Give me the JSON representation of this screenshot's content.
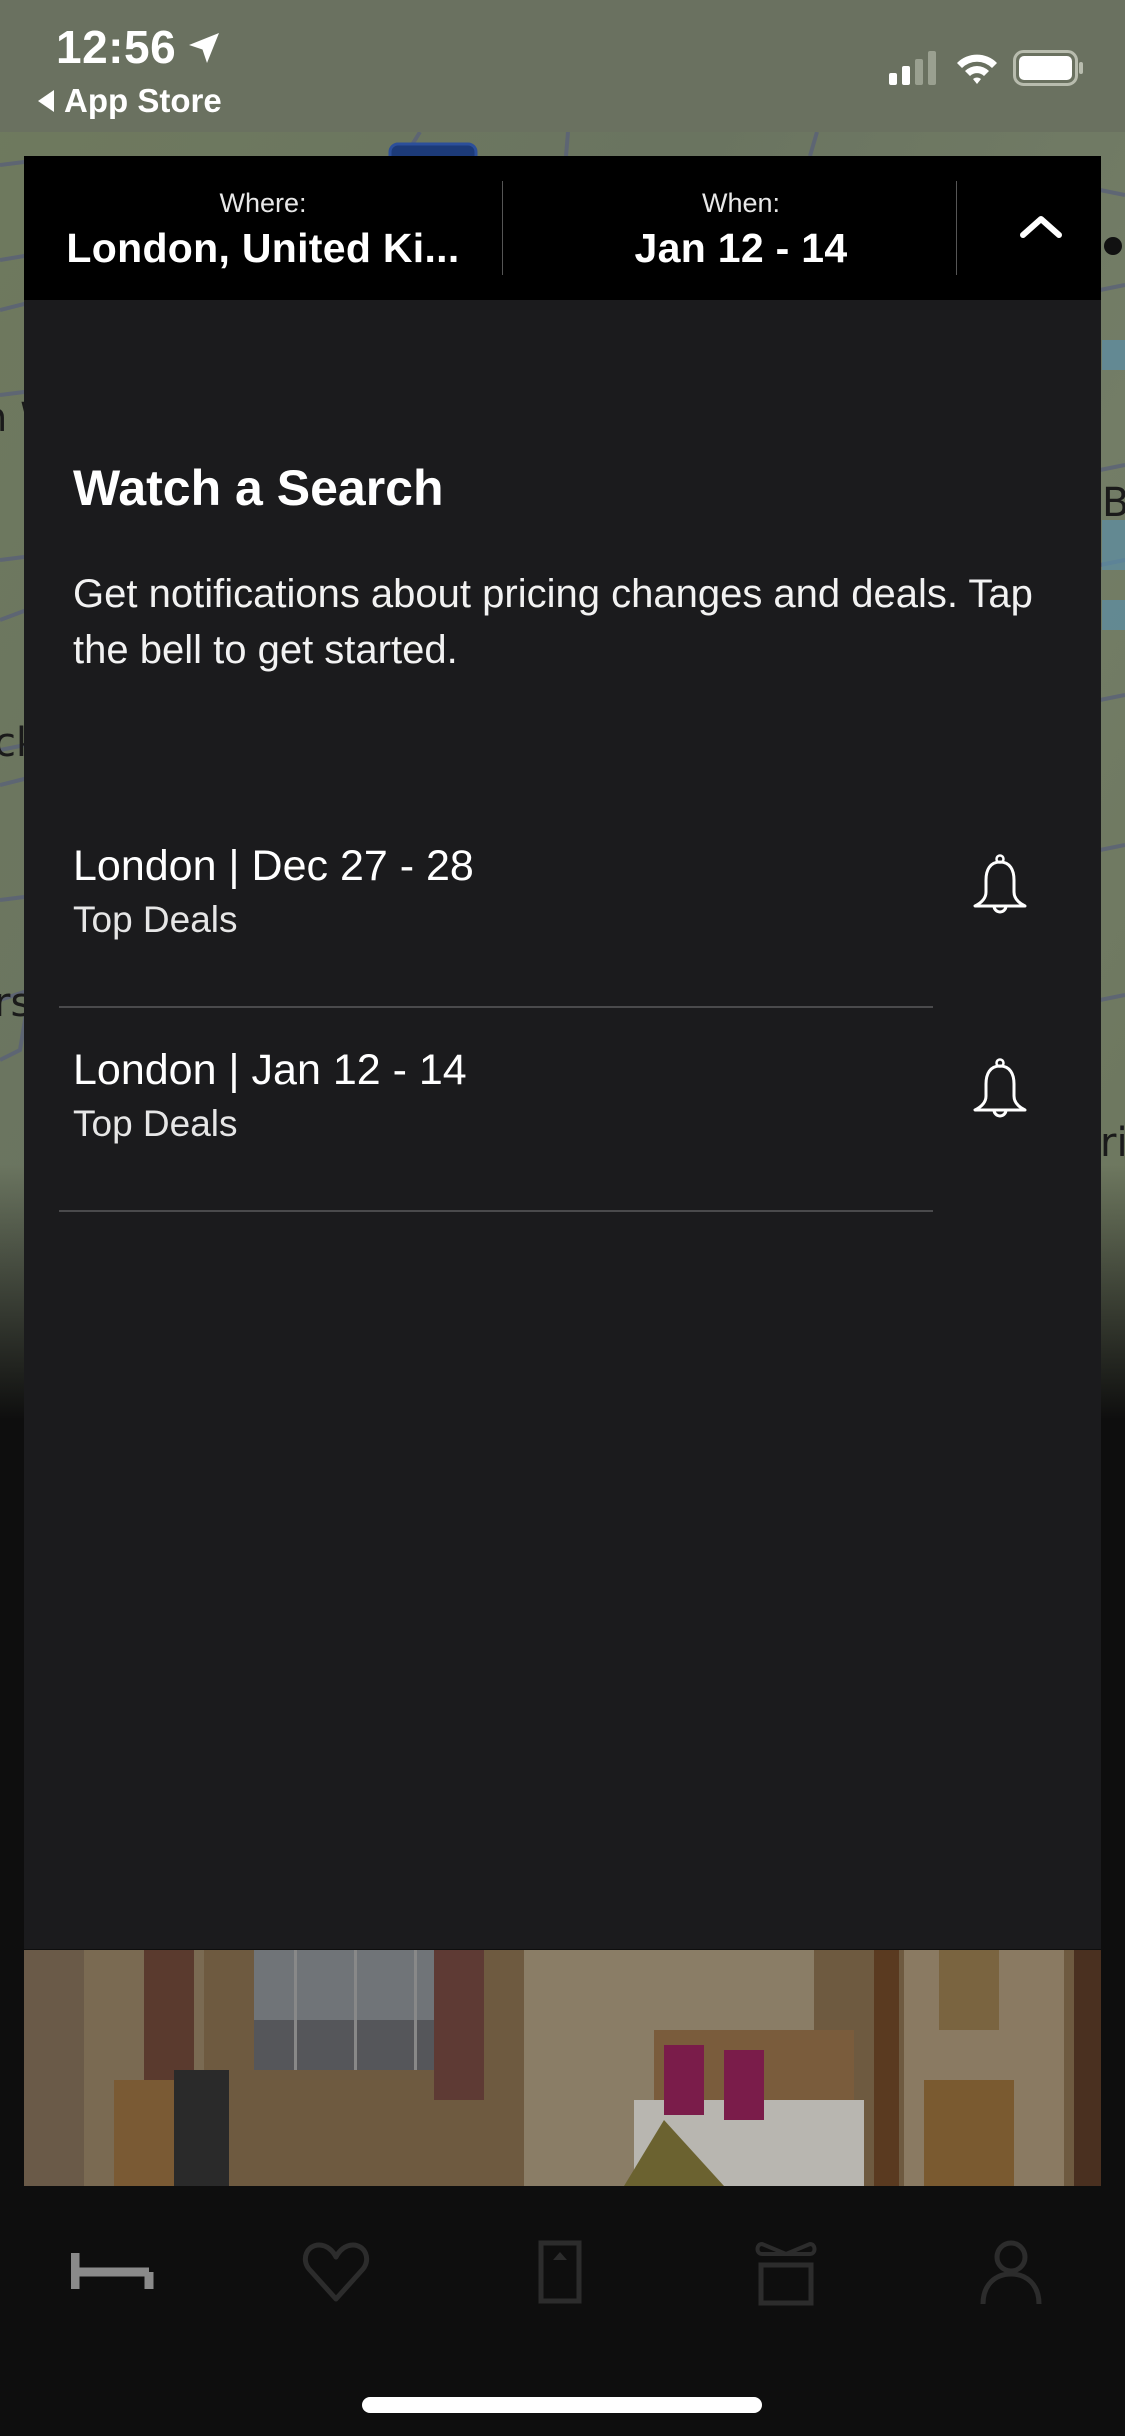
{
  "status_bar": {
    "time": "12:56",
    "back_label": "App Store",
    "icons": [
      "location-arrow-icon",
      "cellular-signal-icon",
      "wifi-icon",
      "battery-icon"
    ]
  },
  "map_labels": [
    "n W",
    "ck",
    "rs",
    "B",
    "ri"
  ],
  "search": {
    "where_label": "Where:",
    "where_value": "London, United Ki...",
    "when_label": "When:",
    "when_value": "Jan 12 - 14",
    "collapse_icon": "chevron-up-icon"
  },
  "watch": {
    "title": "Watch a Search",
    "description": "Get notifications about pricing changes and deals. Tap the bell to get started.",
    "items": [
      {
        "title": "London | Dec 27 - 28",
        "subtitle": "Top Deals",
        "icon": "bell-icon"
      },
      {
        "title": "London | Jan 12 - 14",
        "subtitle": "Top Deals",
        "icon": "bell-icon"
      }
    ]
  },
  "tabbar": {
    "active_index": 0,
    "tabs": [
      {
        "name": "stays",
        "icon": "bed-icon"
      },
      {
        "name": "favorites",
        "icon": "heart-icon"
      },
      {
        "name": "trips",
        "icon": "door-icon"
      },
      {
        "name": "rewards",
        "icon": "gift-icon"
      },
      {
        "name": "account",
        "icon": "person-icon"
      }
    ]
  },
  "colors": {
    "panel_bg": "#1b1b1d",
    "header_bg": "#000000",
    "active_tab": "#8a8a8a",
    "inactive_tab": "#2c2c2c"
  }
}
